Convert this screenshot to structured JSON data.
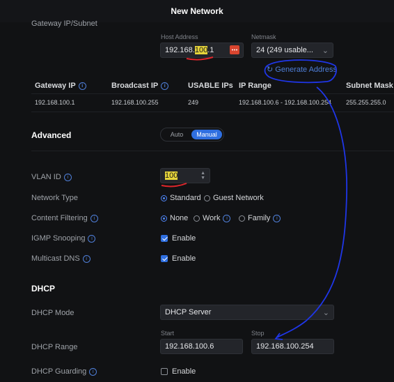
{
  "title": "New Network",
  "gateway": {
    "row_label": "Gateway IP/Subnet",
    "host_label": "Host Address",
    "netmask_label": "Netmask",
    "host_prefix": "192.168.",
    "host_highlight": "100",
    "host_suffix": ".1",
    "netmask_value": "24 (249 usable...",
    "generate_label": "Generate Address"
  },
  "subnet_table": {
    "headers": [
      "Gateway IP",
      "Broadcast IP",
      "USABLE IPs",
      "IP Range",
      "Subnet Mask"
    ],
    "values": [
      "192.168.100.1",
      "192.168.100.255",
      "249",
      "192.168.100.6 - 192.168.100.254",
      "255.255.255.0"
    ]
  },
  "advanced": {
    "label": "Advanced",
    "auto_label": "Auto",
    "manual_label": "Manual"
  },
  "vlan": {
    "label": "VLAN ID",
    "value": "100"
  },
  "network_type": {
    "label": "Network Type",
    "options": [
      "Standard",
      "Guest Network"
    ]
  },
  "content_filtering": {
    "label": "Content Filtering",
    "options": [
      "None",
      "Work",
      "Family"
    ]
  },
  "igmp": {
    "label": "IGMP Snooping",
    "option": "Enable"
  },
  "mdns": {
    "label": "Multicast DNS",
    "option": "Enable"
  },
  "dhcp": {
    "section": "DHCP",
    "mode_label": "DHCP Mode",
    "mode_value": "DHCP Server",
    "range_label": "DHCP Range",
    "start_label": "Start",
    "stop_label": "Stop",
    "start_value": "192.168.100.6",
    "stop_value": "192.168.100.254",
    "guarding_label": "DHCP Guarding",
    "guarding_option": "Enable"
  },
  "colors": {
    "accent": "#2f6fe0",
    "annotation": "#1f36e8",
    "underline": "#e0262b",
    "highlight": "#e6d43a"
  }
}
